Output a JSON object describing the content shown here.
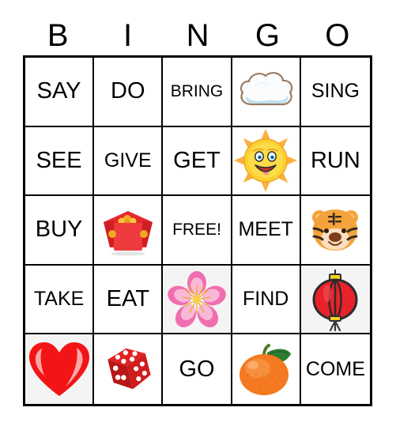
{
  "card": {
    "title_letters": [
      "B",
      "I",
      "N",
      "G",
      "O"
    ],
    "free_space_label": "FREE!",
    "grid": [
      [
        {
          "type": "text",
          "label": "SAY"
        },
        {
          "type": "text",
          "label": "DO"
        },
        {
          "type": "text",
          "label": "BRING"
        },
        {
          "type": "image",
          "icon": "cloud-icon",
          "label": "cloud"
        },
        {
          "type": "text",
          "label": "SING"
        }
      ],
      [
        {
          "type": "text",
          "label": "SEE"
        },
        {
          "type": "text",
          "label": "GIVE"
        },
        {
          "type": "text",
          "label": "GET"
        },
        {
          "type": "image",
          "icon": "smiling-sun-icon",
          "label": "sun"
        },
        {
          "type": "text",
          "label": "RUN"
        }
      ],
      [
        {
          "type": "text",
          "label": "BUY"
        },
        {
          "type": "image",
          "icon": "red-envelope-icon",
          "label": "red envelope"
        },
        {
          "type": "text",
          "label": "FREE!"
        },
        {
          "type": "text",
          "label": "MEET"
        },
        {
          "type": "image",
          "icon": "tiger-face-icon",
          "label": "tiger face"
        }
      ],
      [
        {
          "type": "text",
          "label": "TAKE"
        },
        {
          "type": "text",
          "label": "EAT"
        },
        {
          "type": "image",
          "icon": "cherry-blossom-icon",
          "label": "cherry blossom"
        },
        {
          "type": "text",
          "label": "FIND"
        },
        {
          "type": "image",
          "icon": "red-lantern-icon",
          "label": "red paper lantern"
        }
      ],
      [
        {
          "type": "image",
          "icon": "heart-icon",
          "label": "red heart"
        },
        {
          "type": "image",
          "icon": "dice-icon",
          "label": "red die"
        },
        {
          "type": "text",
          "label": "GO"
        },
        {
          "type": "image",
          "icon": "tangerine-icon",
          "label": "tangerine"
        },
        {
          "type": "text",
          "label": "COME"
        }
      ]
    ]
  },
  "colors": {
    "grid_line": "#000000",
    "text": "#000000",
    "background": "#ffffff",
    "tinted_cell": "#f4f4f4",
    "heart_red": "#f31515",
    "lantern_red": "#e8222a",
    "envelope_red": "#e5282b",
    "sun_yellow": "#ffd33a",
    "tiger_orange": "#f5a council",
    "blossom_pink": "#f472b6",
    "tangerine_orange": "#f47920"
  }
}
